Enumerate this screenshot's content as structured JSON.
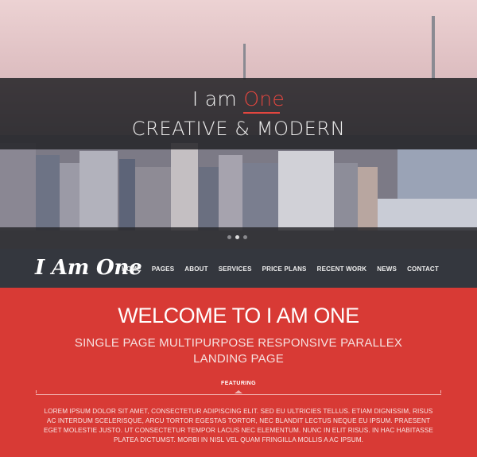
{
  "hero": {
    "title_prefix": "I am ",
    "title_accent": "One",
    "subtitle": "CREATIVE & MODERN",
    "slides": [
      "",
      "",
      ""
    ],
    "active_slide": 2
  },
  "nav": {
    "logo": "I Am One",
    "items": [
      "HOME",
      "PAGES",
      "ABOUT",
      "SERVICES",
      "PRICE PLANS",
      "RECENT WORK",
      "NEWS",
      "CONTACT"
    ]
  },
  "welcome": {
    "title": "WELCOME TO I AM ONE",
    "subtitle_line1": "SINGLE PAGE MULTIPURPOSE RESPONSIVE PARALLEX",
    "subtitle_line2": "LANDING PAGE",
    "featuring": "FEATURING",
    "body": "LOREM IPSUM DOLOR SIT AMET, CONSECTETUR ADIPISCING ELIT. SED EU ULTRICIES TELLUS. ETIAM DIGNISSIM, RISUS AC INTERDUM SCELERISQUE, ARCU TORTOR EGESTAS TORTOR, NEC BLANDIT LECTUS NEQUE EU IPSUM. PRAESENT EGET MOLESTIE JUSTO. UT CONSECTETUR TEMPOR LACUS NEC ELEMENTUM. NUNC IN ELIT RISUS. IN HAC HABITASSE PLATEA DICTUMST. MORBI IN NISL VEL QUAM FRINGILLA MOLLIS A AC IPSUM."
  },
  "colors": {
    "accent": "#e3463f",
    "welcome_bg": "#d83a35",
    "nav_bg": "#34373e"
  }
}
